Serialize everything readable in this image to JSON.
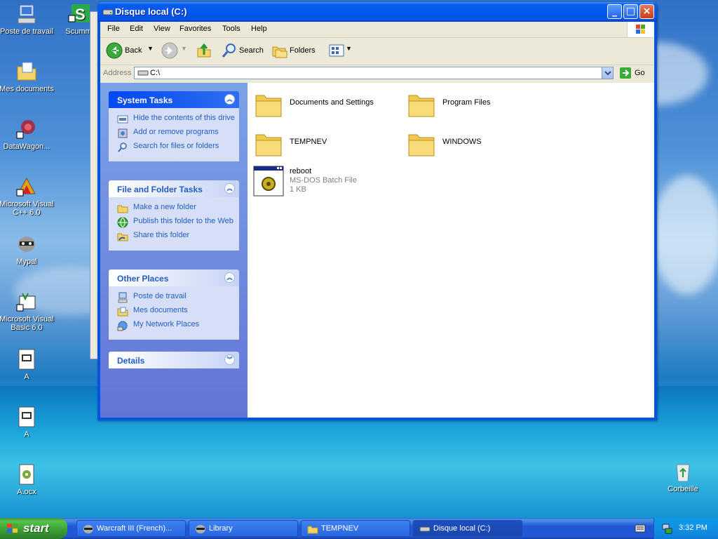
{
  "window": {
    "title": "Disque local (C:)",
    "controls": {
      "minimize": "_",
      "maximize": "□",
      "close": "×"
    }
  },
  "menubar": [
    "File",
    "Edit",
    "View",
    "Favorites",
    "Tools",
    "Help"
  ],
  "toolbar": {
    "back_label": "Back",
    "search_label": "Search",
    "folders_label": "Folders"
  },
  "address": {
    "label": "Address",
    "value": "C:\\",
    "go_label": "Go"
  },
  "taskpane": {
    "system_tasks": {
      "title": "System Tasks",
      "items": [
        "Hide the contents of this drive",
        "Add or remove programs",
        "Search for files or folders"
      ]
    },
    "file_folder_tasks": {
      "title": "File and Folder Tasks",
      "items": [
        "Make a new folder",
        "Publish this folder to the Web",
        "Share this folder"
      ]
    },
    "other_places": {
      "title": "Other Places",
      "items": [
        "Poste de travail",
        "Mes documents",
        "My Network Places"
      ]
    },
    "details": {
      "title": "Details"
    }
  },
  "files": [
    {
      "name": "Documents and Settings",
      "type": "folder"
    },
    {
      "name": "Program Files",
      "type": "folder"
    },
    {
      "name": "TEMPNEV",
      "type": "folder"
    },
    {
      "name": "WINDOWS",
      "type": "folder"
    },
    {
      "name": "reboot",
      "type": "batch",
      "subtitle": "MS-DOS Batch File",
      "size": "1 KB"
    }
  ],
  "desktop_icons": [
    {
      "label": "Poste de travail"
    },
    {
      "label": "Mes documents"
    },
    {
      "label": "DataWagon..."
    },
    {
      "label": "Microsoft Visual C++ 6.0"
    },
    {
      "label": "Mypal"
    },
    {
      "label": "Microsoft Visual Basic 6.0"
    },
    {
      "label": "A"
    },
    {
      "label": "A"
    },
    {
      "label": "A.ocx"
    },
    {
      "label": "Scumm"
    },
    {
      "label": "Corbeille"
    }
  ],
  "taskbar": {
    "start_label": "start",
    "buttons": [
      {
        "label": "Warcraft III (French)..."
      },
      {
        "label": "Library"
      },
      {
        "label": "TEMPNEV"
      },
      {
        "label": "Disque local (C:)"
      }
    ],
    "clock": "3:32 PM"
  },
  "colors": {
    "titlebar": "#0058ee",
    "taskpane_link": "#215dc6",
    "start_green": "#3b9c34"
  }
}
